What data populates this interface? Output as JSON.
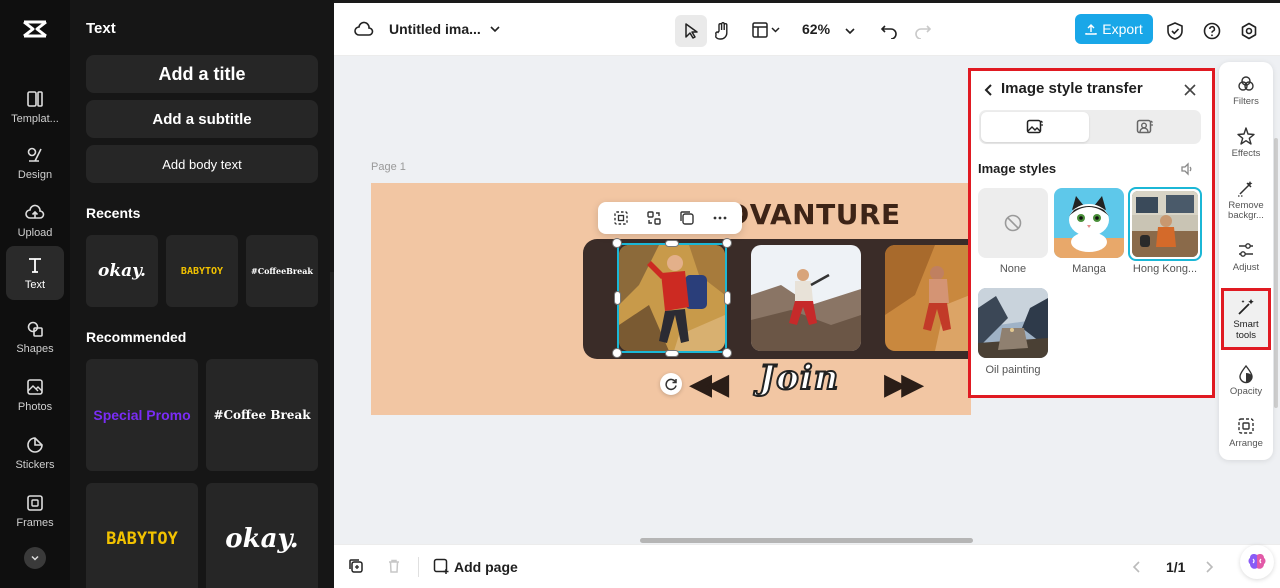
{
  "rail": {
    "items": [
      {
        "label": "Templat..."
      },
      {
        "label": "Design"
      },
      {
        "label": "Upload"
      },
      {
        "label": "Text"
      },
      {
        "label": "Shapes"
      },
      {
        "label": "Photos"
      },
      {
        "label": "Stickers"
      },
      {
        "label": "Frames"
      }
    ],
    "active": "Text"
  },
  "panel": {
    "title": "Text",
    "add_title": "Add a title",
    "add_subtitle": "Add a subtitle",
    "add_body": "Add body text",
    "recents_label": "Recents",
    "recents": [
      "okay.",
      "BABYTOY",
      "#CoffeeBreak"
    ],
    "recommended_label": "Recommended",
    "recommended": [
      "Special Promo",
      "#Coffee Break",
      "BABYTOY",
      "okay."
    ]
  },
  "topbar": {
    "title": "Untitled ima...",
    "zoom": "62%",
    "export_label": "Export",
    "accent": "#19a7e8"
  },
  "canvas": {
    "page_label": "Page 1",
    "headline": "DVANTURE",
    "join_text": "Join"
  },
  "style_panel": {
    "title": "Image style transfer",
    "section": "Image styles",
    "styles": [
      {
        "label": "None"
      },
      {
        "label": "Manga"
      },
      {
        "label": "Hong Kong..."
      },
      {
        "label": "Oil painting"
      }
    ],
    "selected": "Hong Kong...",
    "highlight": "#e01a22"
  },
  "right_tools": [
    {
      "label": "Filters"
    },
    {
      "label": "Effects"
    },
    {
      "label": "Remove backgr..."
    },
    {
      "label": "Adjust"
    },
    {
      "label": "Smart tools"
    },
    {
      "label": "Opacity"
    },
    {
      "label": "Arrange"
    }
  ],
  "bottombar": {
    "add_page": "Add page",
    "page_indicator": "1/1"
  }
}
